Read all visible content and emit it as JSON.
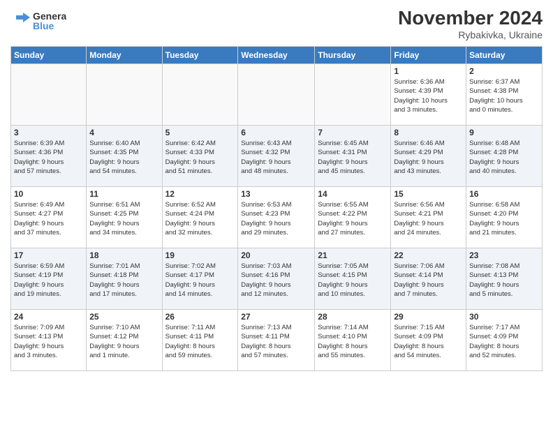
{
  "logo": {
    "line1": "General",
    "line2": "Blue"
  },
  "header": {
    "title": "November 2024",
    "subtitle": "Rybakivka, Ukraine"
  },
  "weekdays": [
    "Sunday",
    "Monday",
    "Tuesday",
    "Wednesday",
    "Thursday",
    "Friday",
    "Saturday"
  ],
  "weeks": [
    [
      {
        "day": "",
        "info": ""
      },
      {
        "day": "",
        "info": ""
      },
      {
        "day": "",
        "info": ""
      },
      {
        "day": "",
        "info": ""
      },
      {
        "day": "",
        "info": ""
      },
      {
        "day": "1",
        "info": "Sunrise: 6:36 AM\nSunset: 4:39 PM\nDaylight: 10 hours\nand 3 minutes."
      },
      {
        "day": "2",
        "info": "Sunrise: 6:37 AM\nSunset: 4:38 PM\nDaylight: 10 hours\nand 0 minutes."
      }
    ],
    [
      {
        "day": "3",
        "info": "Sunrise: 6:39 AM\nSunset: 4:36 PM\nDaylight: 9 hours\nand 57 minutes."
      },
      {
        "day": "4",
        "info": "Sunrise: 6:40 AM\nSunset: 4:35 PM\nDaylight: 9 hours\nand 54 minutes."
      },
      {
        "day": "5",
        "info": "Sunrise: 6:42 AM\nSunset: 4:33 PM\nDaylight: 9 hours\nand 51 minutes."
      },
      {
        "day": "6",
        "info": "Sunrise: 6:43 AM\nSunset: 4:32 PM\nDaylight: 9 hours\nand 48 minutes."
      },
      {
        "day": "7",
        "info": "Sunrise: 6:45 AM\nSunset: 4:31 PM\nDaylight: 9 hours\nand 45 minutes."
      },
      {
        "day": "8",
        "info": "Sunrise: 6:46 AM\nSunset: 4:29 PM\nDaylight: 9 hours\nand 43 minutes."
      },
      {
        "day": "9",
        "info": "Sunrise: 6:48 AM\nSunset: 4:28 PM\nDaylight: 9 hours\nand 40 minutes."
      }
    ],
    [
      {
        "day": "10",
        "info": "Sunrise: 6:49 AM\nSunset: 4:27 PM\nDaylight: 9 hours\nand 37 minutes."
      },
      {
        "day": "11",
        "info": "Sunrise: 6:51 AM\nSunset: 4:25 PM\nDaylight: 9 hours\nand 34 minutes."
      },
      {
        "day": "12",
        "info": "Sunrise: 6:52 AM\nSunset: 4:24 PM\nDaylight: 9 hours\nand 32 minutes."
      },
      {
        "day": "13",
        "info": "Sunrise: 6:53 AM\nSunset: 4:23 PM\nDaylight: 9 hours\nand 29 minutes."
      },
      {
        "day": "14",
        "info": "Sunrise: 6:55 AM\nSunset: 4:22 PM\nDaylight: 9 hours\nand 27 minutes."
      },
      {
        "day": "15",
        "info": "Sunrise: 6:56 AM\nSunset: 4:21 PM\nDaylight: 9 hours\nand 24 minutes."
      },
      {
        "day": "16",
        "info": "Sunrise: 6:58 AM\nSunset: 4:20 PM\nDaylight: 9 hours\nand 21 minutes."
      }
    ],
    [
      {
        "day": "17",
        "info": "Sunrise: 6:59 AM\nSunset: 4:19 PM\nDaylight: 9 hours\nand 19 minutes."
      },
      {
        "day": "18",
        "info": "Sunrise: 7:01 AM\nSunset: 4:18 PM\nDaylight: 9 hours\nand 17 minutes."
      },
      {
        "day": "19",
        "info": "Sunrise: 7:02 AM\nSunset: 4:17 PM\nDaylight: 9 hours\nand 14 minutes."
      },
      {
        "day": "20",
        "info": "Sunrise: 7:03 AM\nSunset: 4:16 PM\nDaylight: 9 hours\nand 12 minutes."
      },
      {
        "day": "21",
        "info": "Sunrise: 7:05 AM\nSunset: 4:15 PM\nDaylight: 9 hours\nand 10 minutes."
      },
      {
        "day": "22",
        "info": "Sunrise: 7:06 AM\nSunset: 4:14 PM\nDaylight: 9 hours\nand 7 minutes."
      },
      {
        "day": "23",
        "info": "Sunrise: 7:08 AM\nSunset: 4:13 PM\nDaylight: 9 hours\nand 5 minutes."
      }
    ],
    [
      {
        "day": "24",
        "info": "Sunrise: 7:09 AM\nSunset: 4:13 PM\nDaylight: 9 hours\nand 3 minutes."
      },
      {
        "day": "25",
        "info": "Sunrise: 7:10 AM\nSunset: 4:12 PM\nDaylight: 9 hours\nand 1 minute."
      },
      {
        "day": "26",
        "info": "Sunrise: 7:11 AM\nSunset: 4:11 PM\nDaylight: 8 hours\nand 59 minutes."
      },
      {
        "day": "27",
        "info": "Sunrise: 7:13 AM\nSunset: 4:11 PM\nDaylight: 8 hours\nand 57 minutes."
      },
      {
        "day": "28",
        "info": "Sunrise: 7:14 AM\nSunset: 4:10 PM\nDaylight: 8 hours\nand 55 minutes."
      },
      {
        "day": "29",
        "info": "Sunrise: 7:15 AM\nSunset: 4:09 PM\nDaylight: 8 hours\nand 54 minutes."
      },
      {
        "day": "30",
        "info": "Sunrise: 7:17 AM\nSunset: 4:09 PM\nDaylight: 8 hours\nand 52 minutes."
      }
    ]
  ]
}
